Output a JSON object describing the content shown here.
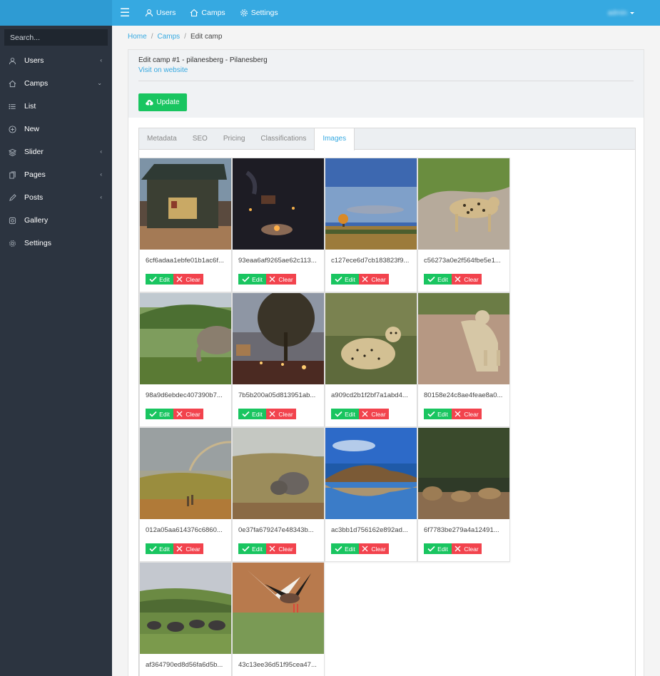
{
  "topbar": {
    "nav": [
      {
        "label": "Users",
        "icon": "user-icon"
      },
      {
        "label": "Camps",
        "icon": "home-icon"
      },
      {
        "label": "Settings",
        "icon": "gear-icon"
      }
    ],
    "user_name": "admin"
  },
  "sidebar": {
    "search_placeholder": "Search...",
    "items": [
      {
        "label": "Users",
        "icon": "user-icon",
        "arrow": "‹"
      },
      {
        "label": "Camps",
        "icon": "home-icon",
        "arrow": "⌄"
      },
      {
        "label": "List",
        "icon": "list-icon",
        "arrow": ""
      },
      {
        "label": "New",
        "icon": "plus-circle-icon",
        "arrow": ""
      },
      {
        "label": "Slider",
        "icon": "layers-icon",
        "arrow": "‹"
      },
      {
        "label": "Pages",
        "icon": "pages-icon",
        "arrow": "‹"
      },
      {
        "label": "Posts",
        "icon": "pencil-icon",
        "arrow": "‹"
      },
      {
        "label": "Gallery",
        "icon": "camera-icon",
        "arrow": ""
      },
      {
        "label": "Settings",
        "icon": "gear-icon",
        "arrow": ""
      }
    ]
  },
  "breadcrumb": {
    "home": "Home",
    "camps": "Camps",
    "current": "Edit camp",
    "separator": "/"
  },
  "header": {
    "title": "Edit camp #1 - pilanesberg - Pilanesberg",
    "visit_link": "Visit on website",
    "update_label": "Update"
  },
  "tabs": [
    {
      "label": "Metadata",
      "active": false
    },
    {
      "label": "SEO",
      "active": false
    },
    {
      "label": "Pricing",
      "active": false
    },
    {
      "label": "Classifications",
      "active": false
    },
    {
      "label": "Images",
      "active": true
    }
  ],
  "images": [
    {
      "name": "6cf6adaa1ebfe01b1ac6f...",
      "scene": "tent-dusk"
    },
    {
      "name": "93eaa6af9265ae62c113...",
      "scene": "campfire-night"
    },
    {
      "name": "c127ece6d7cb183823f9...",
      "scene": "balloon-sky"
    },
    {
      "name": "c56273a0e2f564fbe5e1...",
      "scene": "leopard-road"
    },
    {
      "name": "98a9d6ebdec407390b7...",
      "scene": "elephant-bush"
    },
    {
      "name": "7b5b200a05d813951ab...",
      "scene": "camp-tree-dusk"
    },
    {
      "name": "a909cd2b1f2bf7a1abd4...",
      "scene": "cheetah-grass"
    },
    {
      "name": "80158e24c8ae4feae8a0...",
      "scene": "lioness-road"
    },
    {
      "name": "012a05aa614376c6860...",
      "scene": "rainbow-plains"
    },
    {
      "name": "0e37fa679247e48343b...",
      "scene": "rhino-savanna"
    },
    {
      "name": "ac3bb1d756162e892ad...",
      "scene": "lake-hills"
    },
    {
      "name": "6f7783be279a4a12491...",
      "scene": "lions-bush"
    },
    {
      "name": "af364790ed8d56fa6d5b...",
      "scene": "wildebeest-plains"
    },
    {
      "name": "43c13ee36d51f95cea47...",
      "scene": "bird-water"
    }
  ],
  "image_actions": {
    "edit": "Edit",
    "clear": "Clear"
  },
  "colors": {
    "topbar": "#36a9e1",
    "sidebar": "#2c3440",
    "success": "#19c560",
    "danger": "#f2434d",
    "link": "#36a9e1"
  }
}
